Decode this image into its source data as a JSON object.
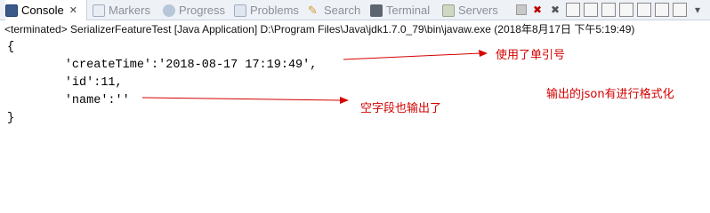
{
  "tabs": [
    {
      "label": "Console",
      "icon": "console-icon",
      "active": true
    },
    {
      "label": "Markers",
      "icon": "markers-icon"
    },
    {
      "label": "Progress",
      "icon": "progress-icon"
    },
    {
      "label": "Problems",
      "icon": "problems-icon"
    },
    {
      "label": "Search",
      "icon": "search-icon"
    },
    {
      "label": "Terminal",
      "icon": "terminal-icon"
    },
    {
      "label": "Servers",
      "icon": "servers-icon"
    }
  ],
  "status_line": "<terminated> SerializerFeatureTest [Java Application] D:\\Program Files\\Java\\jdk1.7.0_79\\bin\\javaw.exe (2018年8月17日 下午5:19:49)",
  "output_lines": [
    "{",
    "\t'createTime':'2018-08-17 17:19:49',",
    "\t'id':11,",
    "\t'name':''",
    "}"
  ],
  "annotations": {
    "single_quote": "使用了单引号",
    "empty_field": "空字段也输出了",
    "formatted": "输出的json有进行格式化"
  },
  "annotation_color": "#d40000"
}
